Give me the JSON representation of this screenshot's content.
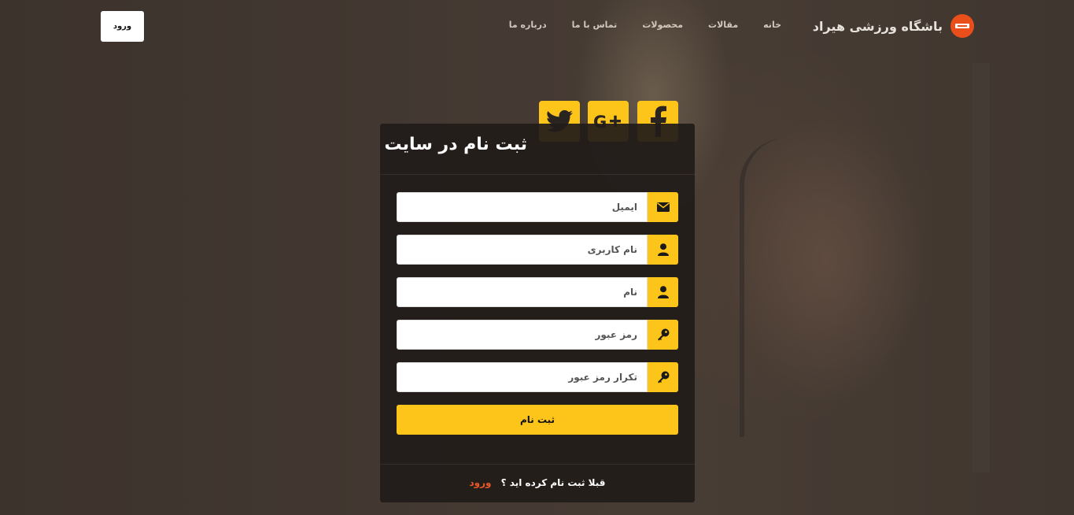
{
  "brand": {
    "name": "باشگاه ورزشی هیراد",
    "logo_icon": "dumbbell-icon",
    "logo_color": "#e94e1b"
  },
  "nav": {
    "items": [
      {
        "label": "خانه"
      },
      {
        "label": "مقالات"
      },
      {
        "label": "محصولات"
      },
      {
        "label": "تماس با ما"
      },
      {
        "label": "درباره ما"
      }
    ],
    "login_label": "ورود"
  },
  "social": {
    "facebook_icon": "facebook-icon",
    "googleplus_icon": "google-plus-icon",
    "twitter_icon": "twitter-icon",
    "accent": "#fdc419"
  },
  "form": {
    "title": "ثبت نام در سایت",
    "fields": [
      {
        "placeholder": "ایمیل",
        "icon": "envelope-icon"
      },
      {
        "placeholder": "نام کاربری",
        "icon": "user-icon"
      },
      {
        "placeholder": "نام",
        "icon": "user-icon"
      },
      {
        "placeholder": "رمز عبور",
        "icon": "key-icon"
      },
      {
        "placeholder": "تکرار رمز عبور",
        "icon": "key-icon"
      }
    ],
    "submit_label": "ثبت نام",
    "footer_question": "قبلا ثبت نام کرده اید ؟",
    "footer_link": "ورود",
    "footer_link_color": "#e9572b"
  }
}
